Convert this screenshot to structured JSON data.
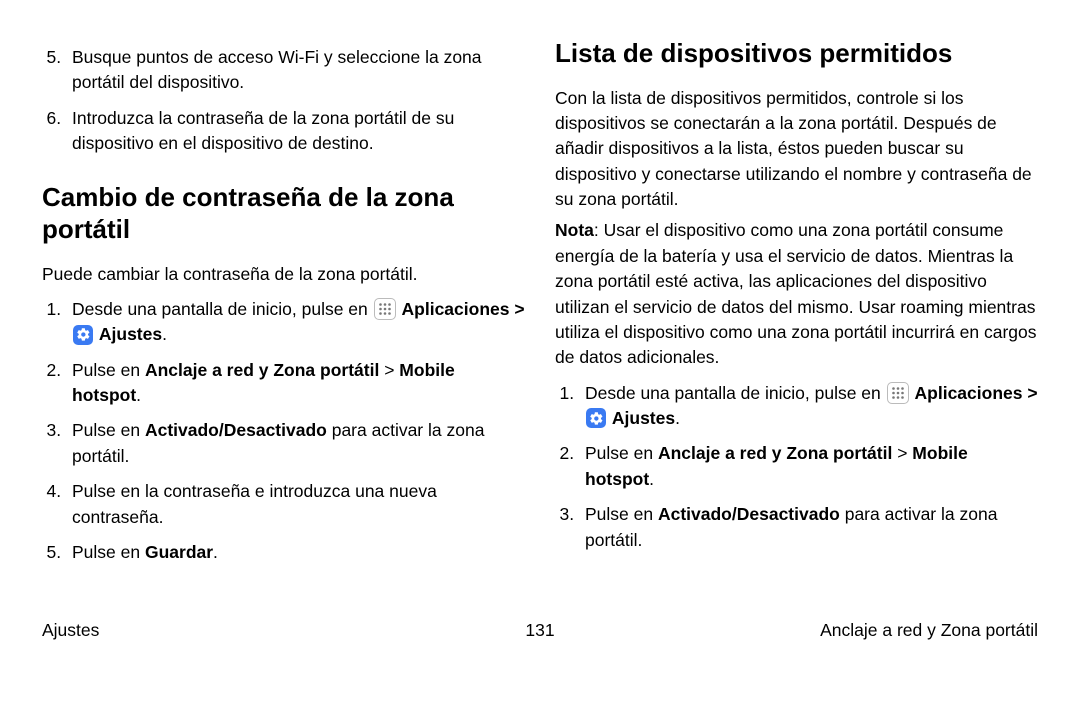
{
  "left": {
    "step5": "Busque puntos de acceso Wi-Fi y seleccione la zona portátil del dispositivo.",
    "step6": "Introduzca la contraseña de la zona portátil de su dispositivo en el dispositivo de destino.",
    "heading": "Cambio de contraseña de la zona portátil",
    "intro": "Puede cambiar la contraseña de la zona portátil.",
    "s1a": "Desde una pantalla de inicio, pulse en",
    "apl": "Aplicaciones",
    "gt1": " > ",
    "aj": "Ajustes",
    "dot": ".",
    "s2a": "Pulse en ",
    "s2b": "Anclaje a red y Zona portátil",
    "s2c": " > ",
    "s2d": "Mobile hotspot",
    "s3a": "Pulse en ",
    "s3b": "Activado/Desactivado",
    "s3c": " para activar la zona portátil.",
    "s4": "Pulse en la contraseña e introduzca una nueva contraseña.",
    "s5a": "Pulse en ",
    "s5b": "Guardar",
    "s5c": "."
  },
  "right": {
    "heading": "Lista de dispositivos permitidos",
    "p1": "Con la lista de dispositivos permitidos, controle si los dispositivos se conectarán a la zona portátil. Después de añadir dispositivos a la lista, éstos pueden buscar su dispositivo y conectarse utilizando el nombre y contraseña de su zona portátil.",
    "noteLabel": "Nota",
    "noteText": ": Usar el dispositivo como una zona portátil consume energía de la batería y usa el servicio de datos. Mientras la zona portátil esté activa, las aplicaciones del dispositivo utilizan el servicio de datos del mismo. Usar roaming mientras utiliza el dispositivo como una zona portátil incurrirá en cargos de datos adicionales.",
    "s1a": "Desde una pantalla de inicio, pulse en",
    "apl": "Aplicaciones",
    "gt1": " > ",
    "aj": "Ajustes",
    "dot": ".",
    "s2a": "Pulse en ",
    "s2b": "Anclaje a red y Zona portátil",
    "s2c": " > ",
    "s2d": "Mobile hotspot",
    "s3a": "Pulse en ",
    "s3b": "Activado/Desactivado",
    "s3c": " para activar la zona portátil."
  },
  "footer": {
    "left": "Ajustes",
    "center": "131",
    "right": "Anclaje a red y Zona portátil"
  }
}
